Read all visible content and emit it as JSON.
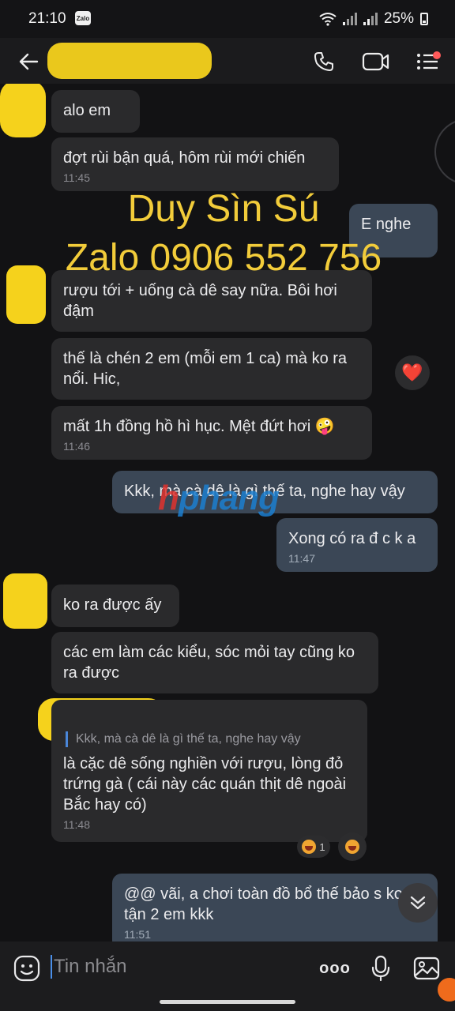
{
  "status_bar": {
    "time": "21:10",
    "app_badge": "Zalo",
    "battery": "25%"
  },
  "header": {
    "icons": [
      "back-arrow-icon",
      "phone-icon",
      "video-icon",
      "menu-icon"
    ]
  },
  "watermark": {
    "line1": "Duy Sìn Sú",
    "line2": "Zalo 0906 552 756",
    "logo_h": "h",
    "logo_rest": "phang"
  },
  "messages": [
    {
      "dir": "in",
      "text": "alo em"
    },
    {
      "dir": "in",
      "text": "đợt rùi bận quá, hôm rùi mới chiến",
      "time": "11:45"
    },
    {
      "dir": "out",
      "text": "E nghe"
    },
    {
      "dir": "in",
      "text": "rượu tới + uống cà dê say nữa. Bôi hơi đậm"
    },
    {
      "dir": "in",
      "text": "thế là chén 2 em (mỗi em 1 ca) mà ko ra nổi. Hic,"
    },
    {
      "dir": "in",
      "text": "mất 1h đồng hồ hì hục. Mệt đứt hơi 🤪",
      "time": "11:46"
    },
    {
      "dir": "out",
      "text": "Kkk, mà cà dê là gì thế ta, nghe hay vậy"
    },
    {
      "dir": "out",
      "text": "Xong có ra đ c k a",
      "time": "11:47"
    },
    {
      "dir": "in",
      "text": "ko ra được ấy"
    },
    {
      "dir": "in",
      "text": "các em làm các kiểu, sóc mỏi tay cũng ko ra được"
    },
    {
      "dir": "in",
      "quote": "Kkk, mà cà dê là gì thế ta, nghe hay vậy",
      "text": "là cặc dê sống nghiền với rượu, lòng đỏ trứng gà ( cái này các quán thịt dê ngoài Bắc hay có)",
      "time": "11:48"
    },
    {
      "dir": "out",
      "text": "@@ vãi, a chơi toàn đồ bổ thế bảo s ko đi tận 2 em kkk",
      "time": "11:51"
    }
  ],
  "reactions": {
    "heart": "❤️",
    "laugh_count": "1"
  },
  "input": {
    "placeholder": "Tin nhắn",
    "more": "ooo"
  },
  "colors": {
    "bubble_in": "#2a2a2c",
    "bubble_out": "#3b4756",
    "background": "#121214",
    "watermark": "#f2cc3a",
    "accent": "#4a86d9"
  }
}
